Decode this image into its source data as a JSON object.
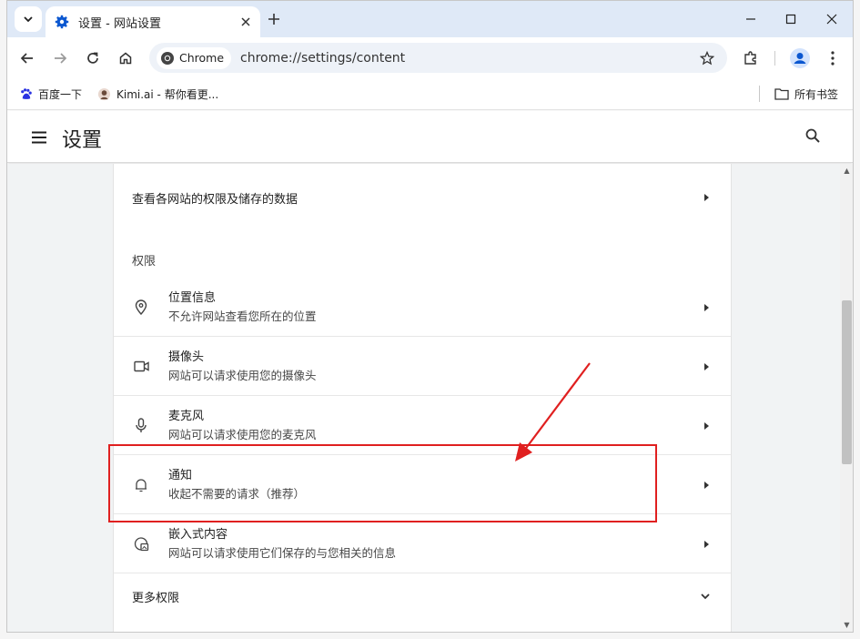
{
  "tab": {
    "title": "设置 - 网站设置"
  },
  "toolbar": {
    "chip_label": "Chrome",
    "url": "chrome://settings/content"
  },
  "bookmarks": {
    "items": [
      {
        "label": "百度一下",
        "icon": "baidu-icon"
      },
      {
        "label": "Kimi.ai - 帮你看更...",
        "icon": "kimi-icon"
      }
    ],
    "all_bookmarks": "所有书签"
  },
  "settings": {
    "title": "设置"
  },
  "content": {
    "site_data_link": "查看各网站的权限及储存的数据",
    "permissions_label": "权限",
    "permissions": [
      {
        "title": "位置信息",
        "subtitle": "不允许网站查看您所在的位置",
        "icon": "location-pin-icon"
      },
      {
        "title": "摄像头",
        "subtitle": "网站可以请求使用您的摄像头",
        "icon": "camera-icon"
      },
      {
        "title": "麦克风",
        "subtitle": "网站可以请求使用您的麦克风",
        "icon": "microphone-icon"
      },
      {
        "title": "通知",
        "subtitle": "收起不需要的请求（推荐）",
        "icon": "bell-icon"
      },
      {
        "title": "嵌入式内容",
        "subtitle": "网站可以请求使用它们保存的与您相关的信息",
        "icon": "embedded-content-icon"
      }
    ],
    "more_permissions": "更多权限"
  },
  "colors": {
    "accent": "#0b57d0",
    "annotation": "#e02020",
    "tab_strip": "#dfe9f7"
  }
}
